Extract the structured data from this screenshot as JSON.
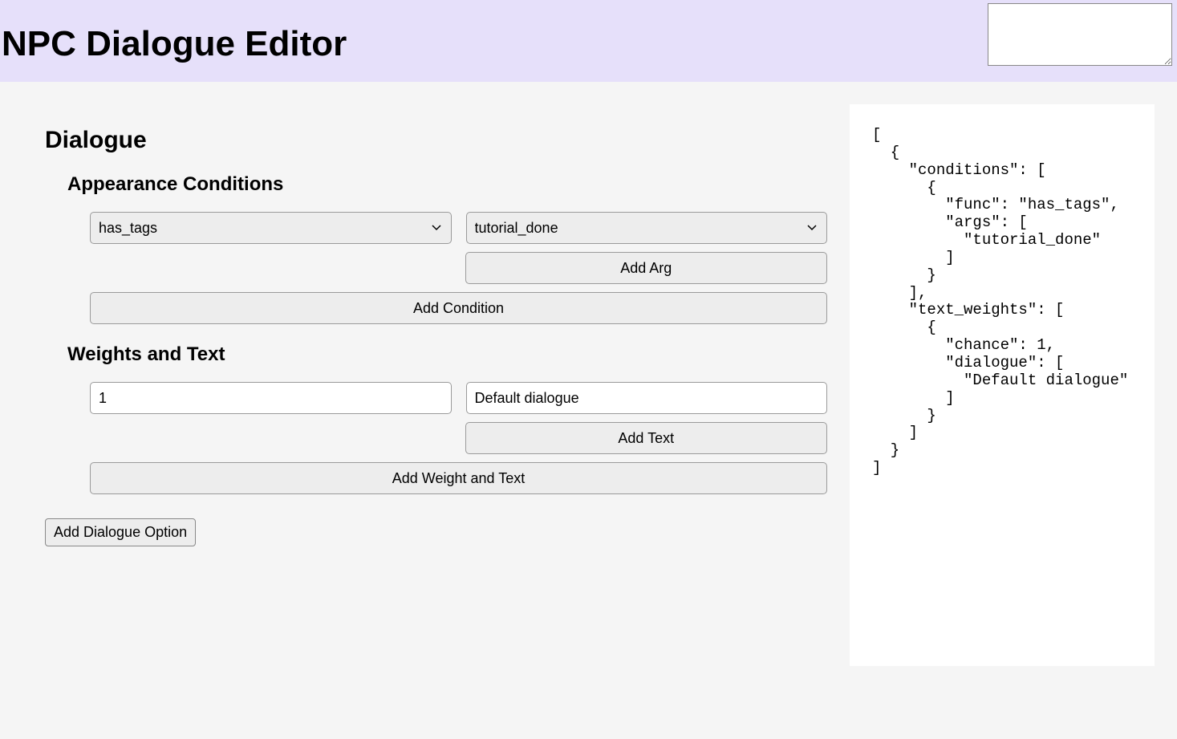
{
  "header": {
    "title": "NPC Dialogue Editor",
    "textarea_value": ""
  },
  "editor": {
    "section_title": "Dialogue",
    "conditions": {
      "title": "Appearance Conditions",
      "rows": [
        {
          "func": "has_tags",
          "args": [
            "tutorial_done"
          ]
        }
      ],
      "add_arg_label": "Add Arg",
      "add_condition_label": "Add Condition"
    },
    "weights": {
      "title": "Weights and Text",
      "rows": [
        {
          "chance": "1",
          "dialogue": [
            "Default dialogue"
          ]
        }
      ],
      "add_text_label": "Add Text",
      "add_weight_label": "Add Weight and Text"
    },
    "add_option_label": "Add Dialogue Option"
  },
  "select_options": {
    "funcs": [
      "has_tags"
    ],
    "args": [
      "tutorial_done"
    ]
  },
  "preview_json": "[\n  {\n    \"conditions\": [\n      {\n        \"func\": \"has_tags\",\n        \"args\": [\n          \"tutorial_done\"\n        ]\n      }\n    ],\n    \"text_weights\": [\n      {\n        \"chance\": 1,\n        \"dialogue\": [\n          \"Default dialogue\"\n        ]\n      }\n    ]\n  }\n]"
}
